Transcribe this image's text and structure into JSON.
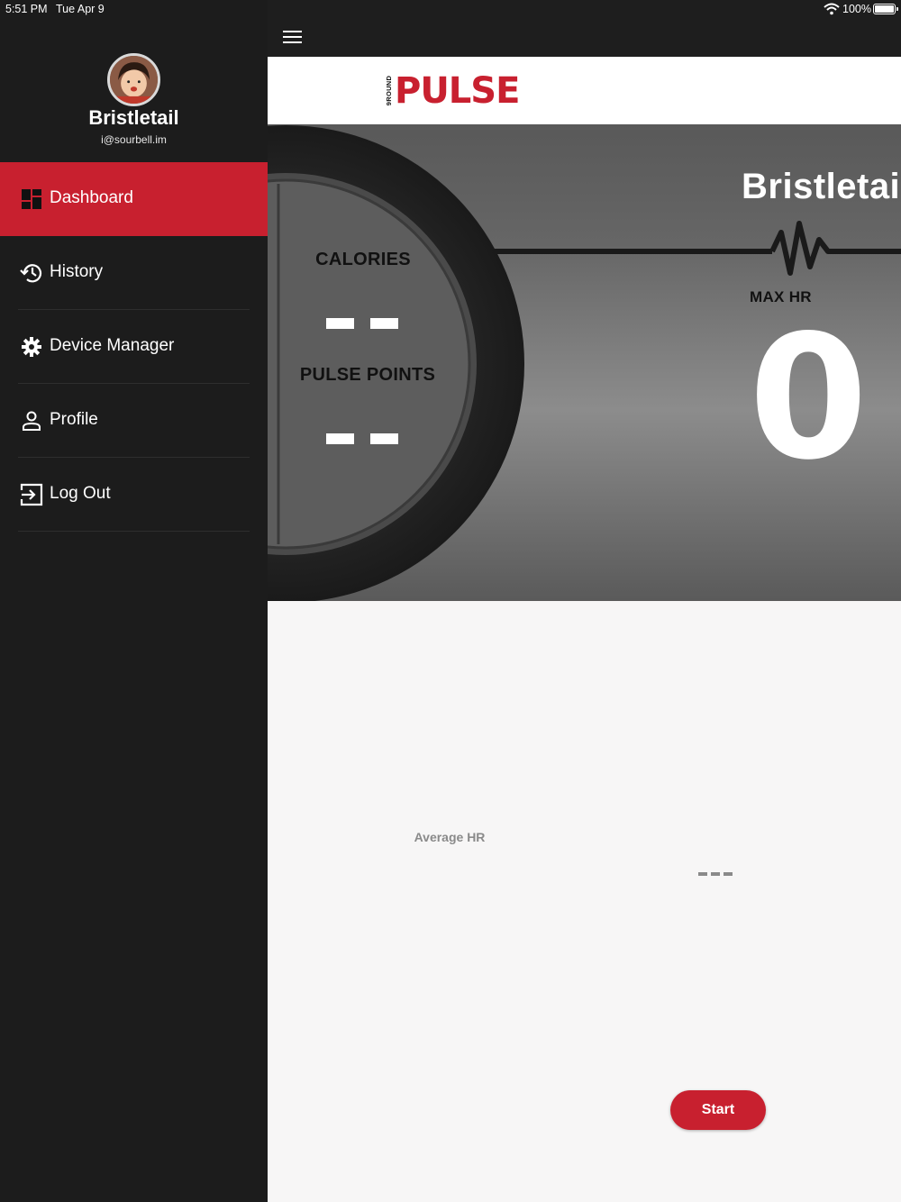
{
  "status_bar": {
    "time": "5:51 PM",
    "date": "Tue Apr 9",
    "battery_percent": "100%"
  },
  "sidebar": {
    "user_name": "Bristletail",
    "user_email": "i@sourbell.im",
    "items": [
      {
        "label": "Dashboard",
        "icon": "dashboard-icon",
        "active": true
      },
      {
        "label": "History",
        "icon": "history-icon",
        "active": false
      },
      {
        "label": "Device Manager",
        "icon": "gear-icon",
        "active": false
      },
      {
        "label": "Profile",
        "icon": "person-icon",
        "active": false
      },
      {
        "label": "Log Out",
        "icon": "logout-icon",
        "active": false
      }
    ]
  },
  "header": {
    "logo_small_text": "9ROUND",
    "logo_text": "PULSE"
  },
  "dashboard": {
    "athlete_name": "Bristletail",
    "calories_label": "CALORIES",
    "pulse_points_label": "PULSE POINTS",
    "max_hr_label": "MAX HR",
    "max_hr_value": "0",
    "average_hr_label": "Average HR",
    "start_label": "Start"
  },
  "colors": {
    "accent": "#c8202f",
    "sidebar_bg": "#1c1c1c",
    "content_bg": "#f7f6f6"
  }
}
